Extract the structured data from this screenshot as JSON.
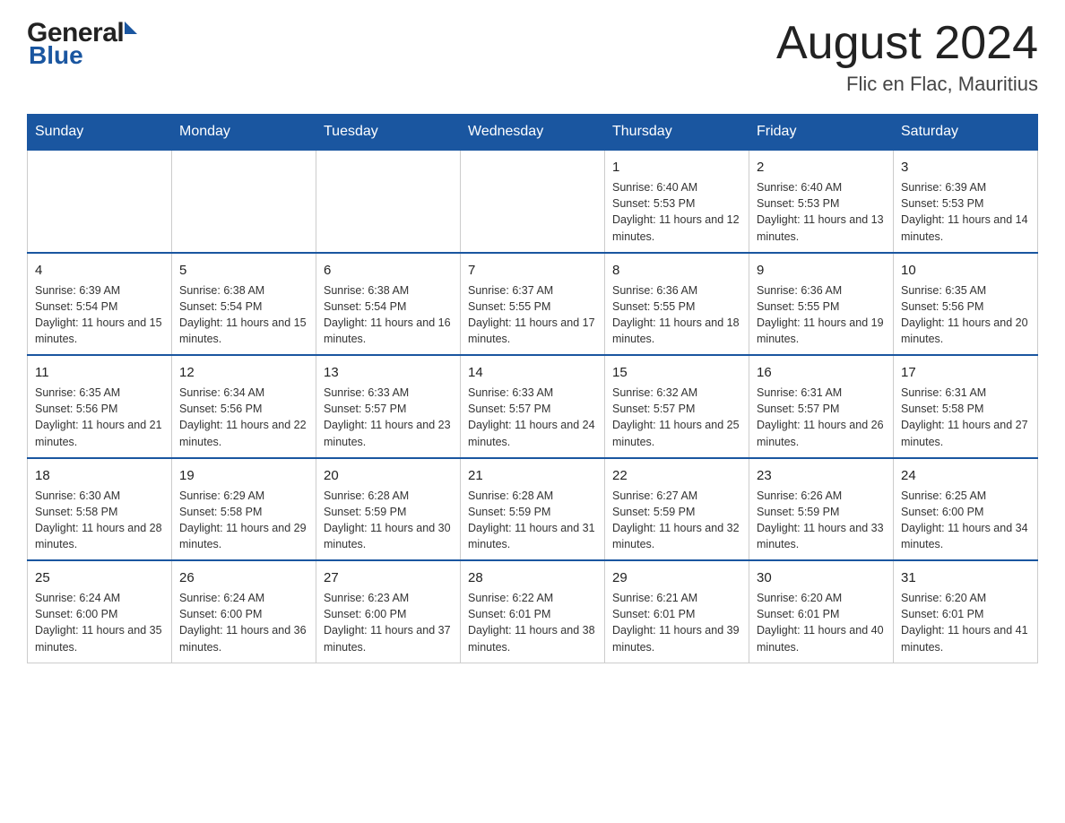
{
  "header": {
    "logo_general": "General",
    "logo_blue": "Blue",
    "month_title": "August 2024",
    "location": "Flic en Flac, Mauritius"
  },
  "weekdays": [
    "Sunday",
    "Monday",
    "Tuesday",
    "Wednesday",
    "Thursday",
    "Friday",
    "Saturday"
  ],
  "weeks": [
    {
      "days": [
        {
          "num": "",
          "info": ""
        },
        {
          "num": "",
          "info": ""
        },
        {
          "num": "",
          "info": ""
        },
        {
          "num": "",
          "info": ""
        },
        {
          "num": "1",
          "info": "Sunrise: 6:40 AM\nSunset: 5:53 PM\nDaylight: 11 hours and 12 minutes."
        },
        {
          "num": "2",
          "info": "Sunrise: 6:40 AM\nSunset: 5:53 PM\nDaylight: 11 hours and 13 minutes."
        },
        {
          "num": "3",
          "info": "Sunrise: 6:39 AM\nSunset: 5:53 PM\nDaylight: 11 hours and 14 minutes."
        }
      ]
    },
    {
      "days": [
        {
          "num": "4",
          "info": "Sunrise: 6:39 AM\nSunset: 5:54 PM\nDaylight: 11 hours and 15 minutes."
        },
        {
          "num": "5",
          "info": "Sunrise: 6:38 AM\nSunset: 5:54 PM\nDaylight: 11 hours and 15 minutes."
        },
        {
          "num": "6",
          "info": "Sunrise: 6:38 AM\nSunset: 5:54 PM\nDaylight: 11 hours and 16 minutes."
        },
        {
          "num": "7",
          "info": "Sunrise: 6:37 AM\nSunset: 5:55 PM\nDaylight: 11 hours and 17 minutes."
        },
        {
          "num": "8",
          "info": "Sunrise: 6:36 AM\nSunset: 5:55 PM\nDaylight: 11 hours and 18 minutes."
        },
        {
          "num": "9",
          "info": "Sunrise: 6:36 AM\nSunset: 5:55 PM\nDaylight: 11 hours and 19 minutes."
        },
        {
          "num": "10",
          "info": "Sunrise: 6:35 AM\nSunset: 5:56 PM\nDaylight: 11 hours and 20 minutes."
        }
      ]
    },
    {
      "days": [
        {
          "num": "11",
          "info": "Sunrise: 6:35 AM\nSunset: 5:56 PM\nDaylight: 11 hours and 21 minutes."
        },
        {
          "num": "12",
          "info": "Sunrise: 6:34 AM\nSunset: 5:56 PM\nDaylight: 11 hours and 22 minutes."
        },
        {
          "num": "13",
          "info": "Sunrise: 6:33 AM\nSunset: 5:57 PM\nDaylight: 11 hours and 23 minutes."
        },
        {
          "num": "14",
          "info": "Sunrise: 6:33 AM\nSunset: 5:57 PM\nDaylight: 11 hours and 24 minutes."
        },
        {
          "num": "15",
          "info": "Sunrise: 6:32 AM\nSunset: 5:57 PM\nDaylight: 11 hours and 25 minutes."
        },
        {
          "num": "16",
          "info": "Sunrise: 6:31 AM\nSunset: 5:57 PM\nDaylight: 11 hours and 26 minutes."
        },
        {
          "num": "17",
          "info": "Sunrise: 6:31 AM\nSunset: 5:58 PM\nDaylight: 11 hours and 27 minutes."
        }
      ]
    },
    {
      "days": [
        {
          "num": "18",
          "info": "Sunrise: 6:30 AM\nSunset: 5:58 PM\nDaylight: 11 hours and 28 minutes."
        },
        {
          "num": "19",
          "info": "Sunrise: 6:29 AM\nSunset: 5:58 PM\nDaylight: 11 hours and 29 minutes."
        },
        {
          "num": "20",
          "info": "Sunrise: 6:28 AM\nSunset: 5:59 PM\nDaylight: 11 hours and 30 minutes."
        },
        {
          "num": "21",
          "info": "Sunrise: 6:28 AM\nSunset: 5:59 PM\nDaylight: 11 hours and 31 minutes."
        },
        {
          "num": "22",
          "info": "Sunrise: 6:27 AM\nSunset: 5:59 PM\nDaylight: 11 hours and 32 minutes."
        },
        {
          "num": "23",
          "info": "Sunrise: 6:26 AM\nSunset: 5:59 PM\nDaylight: 11 hours and 33 minutes."
        },
        {
          "num": "24",
          "info": "Sunrise: 6:25 AM\nSunset: 6:00 PM\nDaylight: 11 hours and 34 minutes."
        }
      ]
    },
    {
      "days": [
        {
          "num": "25",
          "info": "Sunrise: 6:24 AM\nSunset: 6:00 PM\nDaylight: 11 hours and 35 minutes."
        },
        {
          "num": "26",
          "info": "Sunrise: 6:24 AM\nSunset: 6:00 PM\nDaylight: 11 hours and 36 minutes."
        },
        {
          "num": "27",
          "info": "Sunrise: 6:23 AM\nSunset: 6:00 PM\nDaylight: 11 hours and 37 minutes."
        },
        {
          "num": "28",
          "info": "Sunrise: 6:22 AM\nSunset: 6:01 PM\nDaylight: 11 hours and 38 minutes."
        },
        {
          "num": "29",
          "info": "Sunrise: 6:21 AM\nSunset: 6:01 PM\nDaylight: 11 hours and 39 minutes."
        },
        {
          "num": "30",
          "info": "Sunrise: 6:20 AM\nSunset: 6:01 PM\nDaylight: 11 hours and 40 minutes."
        },
        {
          "num": "31",
          "info": "Sunrise: 6:20 AM\nSunset: 6:01 PM\nDaylight: 11 hours and 41 minutes."
        }
      ]
    }
  ]
}
